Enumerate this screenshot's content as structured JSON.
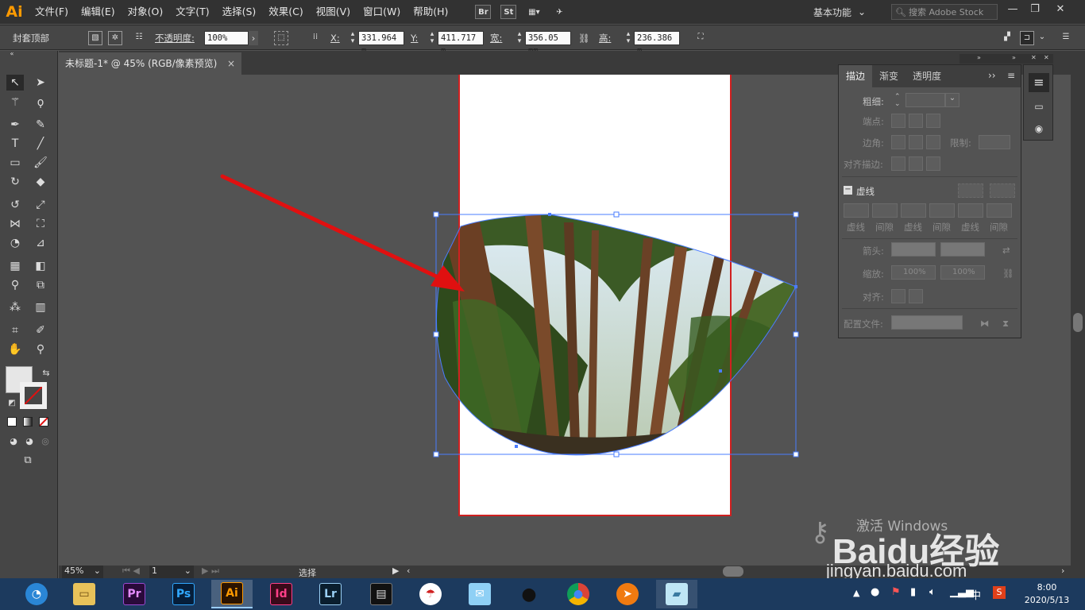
{
  "menubar": {
    "logo": "Ai",
    "items": [
      "文件(F)",
      "编辑(E)",
      "对象(O)",
      "文字(T)",
      "选择(S)",
      "效果(C)",
      "视图(V)",
      "窗口(W)",
      "帮助(H)"
    ],
    "br": "Br",
    "st": "St",
    "workspace": "基本功能",
    "search_placeholder": "搜索 Adobe Stock"
  },
  "controlbar": {
    "selection_label": "封套顶部",
    "opacity_label": "不透明度:",
    "opacity": "100%",
    "x_label": "X:",
    "x": "331.964 m",
    "y_label": "Y:",
    "y": "411.717 m",
    "w_label": "宽:",
    "w": "356.05 mm",
    "h_label": "高:",
    "h": "236.386 m"
  },
  "document": {
    "tab_title": "未标题-1* @ 45% (RGB/像素预览)",
    "close": "×"
  },
  "statusbar": {
    "zoom": "45%",
    "page": "1",
    "mode": "选择"
  },
  "panel": {
    "tabs": [
      "描边",
      "渐变",
      "透明度"
    ],
    "weight_label": "粗细:",
    "cap_label": "端点:",
    "corner_label": "边角:",
    "limit_label": "限制:",
    "align_label": "对齐描边:",
    "dashed_label": "虚线",
    "dash_labels": [
      "虚线",
      "间隙",
      "虚线",
      "间隙",
      "虚线",
      "间隙"
    ],
    "arrow_label": "箭头:",
    "scale_label": "缩放:",
    "scale1": "100%",
    "scale2": "100%",
    "align2_label": "对齐:",
    "profile_label": "配置文件:"
  },
  "taskbar": {
    "apps": [
      "Pr",
      "Ps",
      "Ai",
      "Id",
      "Lr"
    ],
    "time": "8:00",
    "date": "2020/5/13",
    "ime": "中"
  },
  "watermark": {
    "activate": "激活 Windows",
    "brand": "Baidu经验",
    "url": "jingyan.baidu.com"
  },
  "colors": {
    "accent": "#ff9a00",
    "selection": "#4a7cff",
    "arrow": "#e01010"
  }
}
